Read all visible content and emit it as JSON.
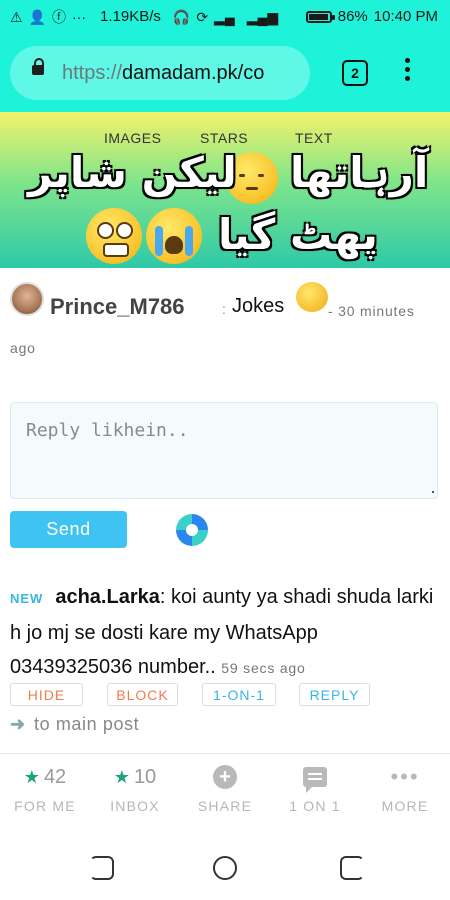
{
  "status_bar": {
    "left_icons": [
      "alert-icon",
      "person-add-icon",
      "facebook-icon",
      "more-icon"
    ],
    "speed": "1.19KB/s",
    "battery": "86%",
    "battery_level": 0.86,
    "time": "10:40 PM"
  },
  "browser": {
    "url_proto": "https://",
    "url_rest": "damadam.pk/co",
    "tab_count": "2"
  },
  "banner": {
    "tabs": [
      "IMAGES",
      "STARS",
      "TEXT"
    ],
    "line1": "آرہاتھا",
    "line1b": "لیکن شاپر",
    "line2": "پھٹ گیا"
  },
  "post": {
    "username": "Prince_M786",
    "separator": ":",
    "topic": "Jokes",
    "time_a": "- 30 minutes",
    "time_b": "ago"
  },
  "reply": {
    "placeholder": "Reply likhein..",
    "send_label": "Send"
  },
  "comment": {
    "badge": "NEW",
    "author": "acha.Larka",
    "text": ": koi aunty ya shadi shuda larki h jo mj se dosti kare my WhatsApp 03439325036 number.. ",
    "time": "59 secs ago",
    "actions": {
      "hide": "HIDE",
      "block": "BLOCK",
      "one_on_one": "1-ON-1",
      "reply": "REPLY"
    }
  },
  "main_link": "to main post",
  "bottom_nav": {
    "for_me_count": "42",
    "for_me": "FOR ME",
    "inbox_count": "10",
    "inbox": "INBOX",
    "share": "SHARE",
    "one_on_one": "1 ON 1",
    "more": "MORE"
  },
  "colors": {
    "browser_bar": "#1ef2d8",
    "accent_blue": "#3ec3f2",
    "accent_orange": "#f17d4e",
    "star_green": "#19a37f"
  }
}
